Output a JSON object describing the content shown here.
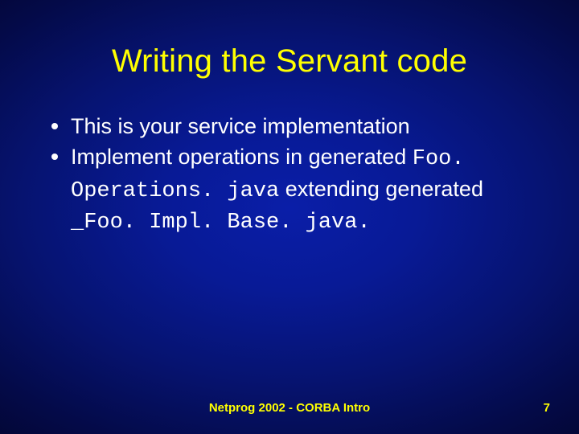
{
  "title": "Writing the Servant code",
  "bullets": {
    "b1": "This is your service implementation",
    "b2_pre": "Implement operations in generated ",
    "b2_code1": "Foo. Operations. java",
    "b2_mid": " extending generated ",
    "b2_code2": "_Foo. Impl. Base. java."
  },
  "footer": {
    "center": "Netprog 2002  -  CORBA Intro",
    "page": "7"
  }
}
